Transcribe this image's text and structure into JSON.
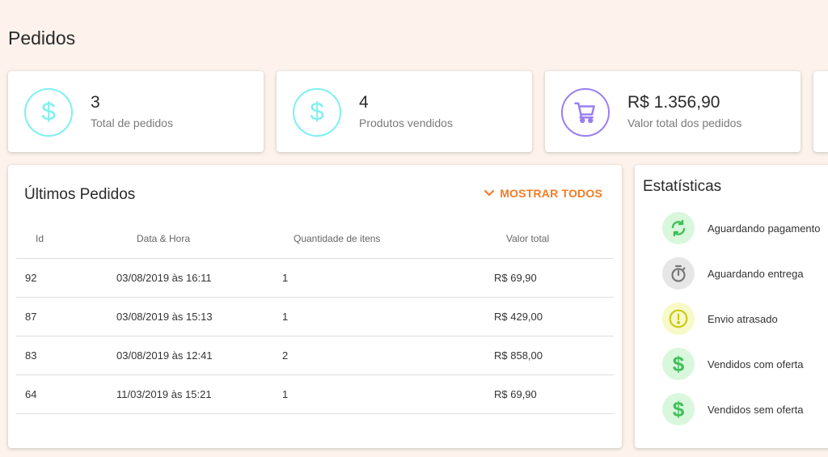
{
  "page": {
    "title": "Pedidos"
  },
  "summary_cards": [
    {
      "value": "3",
      "label": "Total de pedidos",
      "icon": "dollar-icon"
    },
    {
      "value": "4",
      "label": "Produtos vendidos",
      "icon": "dollar-icon"
    },
    {
      "value": "R$ 1.356,90",
      "label": "Valor total dos pedidos",
      "icon": "cart-icon"
    }
  ],
  "orders": {
    "title": "Últimos Pedidos",
    "show_all_label": "MOSTRAR TODOS",
    "columns": [
      "Id",
      "Data & Hora",
      "Quantidade de itens",
      "Valor total"
    ],
    "rows": [
      {
        "id": "92",
        "datetime": "03/08/2019 às 16:11",
        "qty": "1",
        "total": "R$ 69,90"
      },
      {
        "id": "87",
        "datetime": "03/08/2019 às 15:13",
        "qty": "1",
        "total": "R$ 429,00"
      },
      {
        "id": "83",
        "datetime": "03/08/2019 às 12:41",
        "qty": "2",
        "total": "R$ 858,00"
      },
      {
        "id": "64",
        "datetime": "11/03/2019 às 15:21",
        "qty": "1",
        "total": "R$ 69,90"
      }
    ]
  },
  "statistics": {
    "title": "Estatísticas",
    "items": [
      {
        "label": "Aguardando pagamento",
        "icon": "refresh-icon",
        "color": "#3fbf5a",
        "bg": "#d9f7dc"
      },
      {
        "label": "Aguardando entrega",
        "icon": "timer-icon",
        "color": "#777777",
        "bg": "#e6e6e6"
      },
      {
        "label": "Envio atrasado",
        "icon": "alert-icon",
        "color": "#c7c91a",
        "bg": "#f7f9c8"
      },
      {
        "label": "Vendidos com oferta",
        "icon": "dollar-icon",
        "color": "#3fbf5a",
        "bg": "#d9f7dc"
      },
      {
        "label": "Vendidos sem oferta",
        "icon": "dollar-icon",
        "color": "#3fbf5a",
        "bg": "#d9f7dc"
      }
    ]
  },
  "colors": {
    "accent": "#f47b25",
    "cyan": "#7ff0f0",
    "purple": "#9b7ff0",
    "background": "#fdf3ec"
  }
}
